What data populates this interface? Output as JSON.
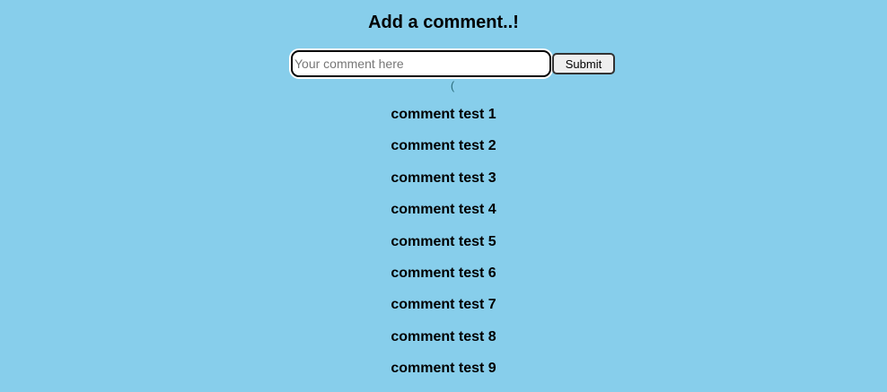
{
  "heading": "Add a comment..!",
  "form": {
    "placeholder": "Your comment here",
    "value": "",
    "submit_label": "Submit"
  },
  "status_text": "(",
  "comments": [
    "comment test 1",
    "comment test 2",
    "comment test 3",
    "comment test 4",
    "comment test 5",
    "comment test 6",
    "comment test 7",
    "comment test 8",
    "comment test 9"
  ]
}
